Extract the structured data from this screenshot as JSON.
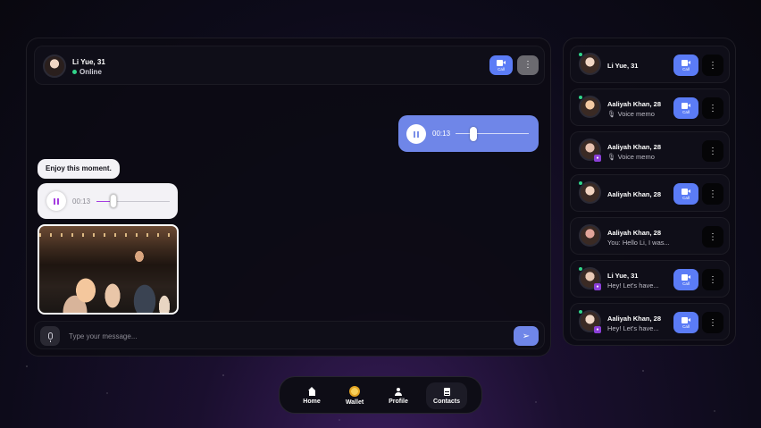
{
  "header": {
    "name": "Li Yue, 31",
    "status": "Online",
    "call_label": "Call",
    "more_glyph": "⋮"
  },
  "messages": {
    "outgoing_voice_time": "00:13",
    "incoming_text": "Enjoy this moment.",
    "incoming_voice_time": "00:13",
    "incoming_voice_progress": 0.2,
    "outgoing_voice_progress": 0.2
  },
  "composer": {
    "placeholder": "Type your message...",
    "send_glyph": "➢"
  },
  "contacts": [
    {
      "name": "Li Yue, 31",
      "preview": "",
      "online": true,
      "call": true,
      "locked": false
    },
    {
      "name": "Aaliyah Khan, 28",
      "preview": "🎙 Voice memo",
      "online": true,
      "call": true,
      "locked": false
    },
    {
      "name": "Aaliyah Khan, 28",
      "preview": "🎙 Voice memo",
      "online": false,
      "call": false,
      "locked": true
    },
    {
      "name": "Aaliyah Khan, 28",
      "preview": "",
      "online": true,
      "call": true,
      "locked": false
    },
    {
      "name": "Aaliyah Khan, 28",
      "preview": "You: Hello Li, I was...",
      "online": false,
      "call": false,
      "locked": false
    },
    {
      "name": "Li Yue, 31",
      "preview": "Hey! Let's have...",
      "online": true,
      "call": true,
      "locked": true
    },
    {
      "name": "Aaliyah Khan, 28",
      "preview": "Hey! Let's have...",
      "online": true,
      "call": true,
      "locked": true
    }
  ],
  "nav": {
    "home": "Home",
    "wallet": "Wallet",
    "profile": "Profile",
    "contacts": "Contacts"
  },
  "colors": {
    "accent": "#5b7cf6",
    "online": "#31d48a",
    "progress": "#a53de0"
  }
}
